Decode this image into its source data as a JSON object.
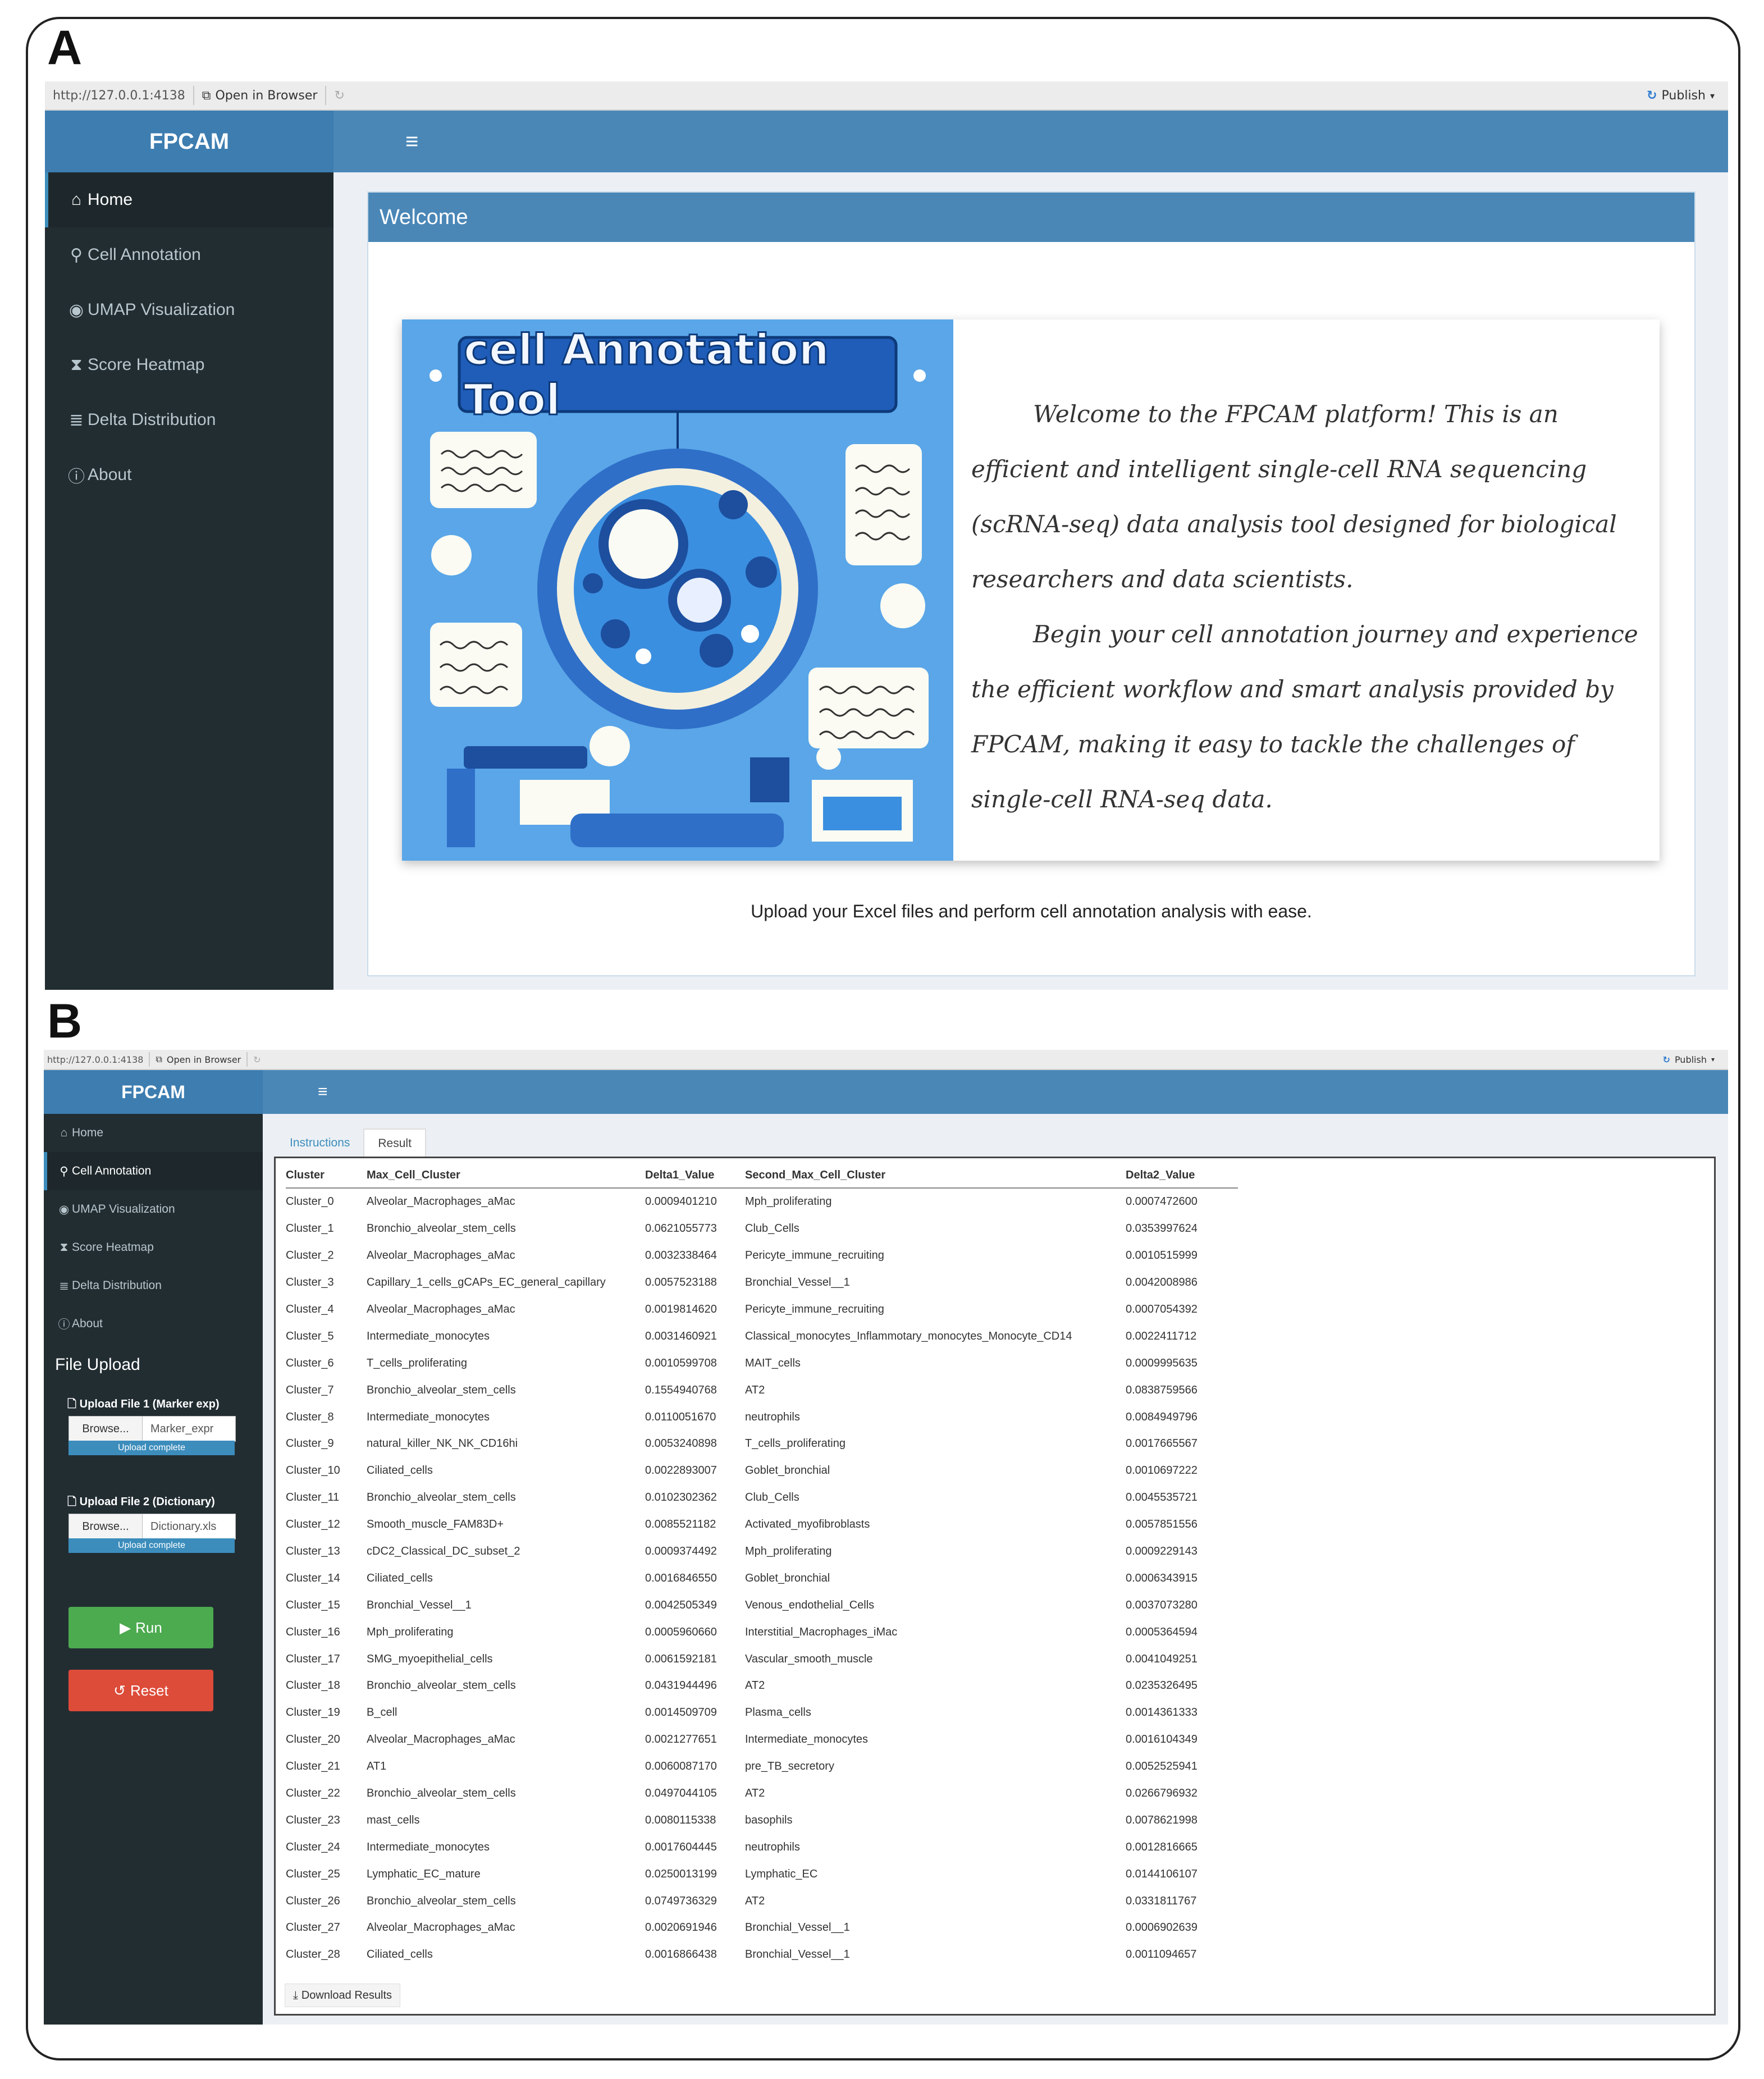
{
  "panel_a": {
    "letter": "A",
    "browser": {
      "url": "http://127.0.0.1:4138",
      "open_in_browser": "Open in Browser",
      "publish": "Publish"
    },
    "app": {
      "logo": "FPCAM",
      "hamburger": "≡",
      "sidebar": [
        {
          "label": "Home",
          "icon": "home-icon",
          "glyph": "⌂"
        },
        {
          "label": "Cell Annotation",
          "icon": "microscope-icon",
          "glyph": "⚲"
        },
        {
          "label": "UMAP Visualization",
          "icon": "eye-icon",
          "glyph": "◉"
        },
        {
          "label": "Score Heatmap",
          "icon": "hourglass-icon",
          "glyph": "⧗"
        },
        {
          "label": "Delta Distribution",
          "icon": "chart-icon",
          "glyph": "≣"
        },
        {
          "label": "About",
          "icon": "info-icon",
          "glyph": "ⓘ"
        }
      ],
      "welcome_title": "Welcome",
      "illustration_title": "cell Annotation Tool",
      "welcome_paragraph_1": "Welcome to the FPCAM platform! This is an efficient and intelligent single-cell RNA sequencing (scRNA-seq) data analysis tool designed for biological researchers and data scientists.",
      "welcome_paragraph_2": "Begin your cell annotation journey and experience the efficient workflow and smart analysis provided by FPCAM, making it easy to tackle the challenges of single-cell RNA-seq data.",
      "footer_text": "Upload your Excel files and perform cell annotation analysis with ease."
    }
  },
  "panel_b": {
    "letter": "B",
    "browser": {
      "url": "http://127.0.0.1:4138",
      "open_in_browser": "Open in Browser",
      "publish": "Publish"
    },
    "app": {
      "logo": "FPCAM",
      "hamburger": "≡",
      "sidebar": [
        {
          "label": "Home",
          "icon": "home-icon",
          "glyph": "⌂"
        },
        {
          "label": "Cell Annotation",
          "icon": "microscope-icon",
          "glyph": "⚲"
        },
        {
          "label": "UMAP Visualization",
          "icon": "eye-icon",
          "glyph": "◉"
        },
        {
          "label": "Score Heatmap",
          "icon": "hourglass-icon",
          "glyph": "⧗"
        },
        {
          "label": "Delta Distribution",
          "icon": "chart-icon",
          "glyph": "≣"
        },
        {
          "label": "About",
          "icon": "info-icon",
          "glyph": "ⓘ"
        }
      ],
      "file_upload_title": "File Upload",
      "upload1": {
        "label": "Upload File 1 (Marker exp)",
        "browse": "Browse...",
        "filename": "Marker_expr",
        "status": "Upload complete"
      },
      "upload2": {
        "label": "Upload File 2 (Dictionary)",
        "browse": "Browse...",
        "filename": "Dictionary.xls",
        "status": "Upload complete"
      },
      "run_label": "Run",
      "reset_label": "Reset",
      "tabs": [
        "Instructions",
        "Result"
      ],
      "table": {
        "headers": [
          "Cluster",
          "Max_Cell_Cluster",
          "Delta1_Value",
          "Second_Max_Cell_Cluster",
          "Delta2_Value"
        ],
        "rows": [
          [
            "Cluster_0",
            "Alveolar_Macrophages_aMac",
            "0.0009401210",
            "Mph_proliferating",
            "0.0007472600"
          ],
          [
            "Cluster_1",
            "Bronchio_alveolar_stem_cells",
            "0.0621055773",
            "Club_Cells",
            "0.0353997624"
          ],
          [
            "Cluster_2",
            "Alveolar_Macrophages_aMac",
            "0.0032338464",
            "Pericyte_immune_recruiting",
            "0.0010515999"
          ],
          [
            "Cluster_3",
            "Capillary_1_cells_gCAPs_EC_general_capillary",
            "0.0057523188",
            "Bronchial_Vessel__1",
            "0.0042008986"
          ],
          [
            "Cluster_4",
            "Alveolar_Macrophages_aMac",
            "0.0019814620",
            "Pericyte_immune_recruiting",
            "0.0007054392"
          ],
          [
            "Cluster_5",
            "Intermediate_monocytes",
            "0.0031460921",
            "Classical_monocytes_Inflammotary_monocytes_Monocyte_CD14",
            "0.0022411712"
          ],
          [
            "Cluster_6",
            "T_cells_proliferating",
            "0.0010599708",
            "MAIT_cells",
            "0.0009995635"
          ],
          [
            "Cluster_7",
            "Bronchio_alveolar_stem_cells",
            "0.1554940768",
            "AT2",
            "0.0838759566"
          ],
          [
            "Cluster_8",
            "Intermediate_monocytes",
            "0.0110051670",
            "neutrophils",
            "0.0084949796"
          ],
          [
            "Cluster_9",
            "natural_killer_NK_NK_CD16hi",
            "0.0053240898",
            "T_cells_proliferating",
            "0.0017665567"
          ],
          [
            "Cluster_10",
            "Ciliated_cells",
            "0.0022893007",
            "Goblet_bronchial",
            "0.0010697222"
          ],
          [
            "Cluster_11",
            "Bronchio_alveolar_stem_cells",
            "0.0102302362",
            "Club_Cells",
            "0.0045535721"
          ],
          [
            "Cluster_12",
            "Smooth_muscle_FAM83D+",
            "0.0085521182",
            "Activated_myofibroblasts",
            "0.0057851556"
          ],
          [
            "Cluster_13",
            "cDC2_Classical_DC_subset_2",
            "0.0009374492",
            "Mph_proliferating",
            "0.0009229143"
          ],
          [
            "Cluster_14",
            "Ciliated_cells",
            "0.0016846550",
            "Goblet_bronchial",
            "0.0006343915"
          ],
          [
            "Cluster_15",
            "Bronchial_Vessel__1",
            "0.0042505349",
            "Venous_endothelial_Cells",
            "0.0037073280"
          ],
          [
            "Cluster_16",
            "Mph_proliferating",
            "0.0005960660",
            "Interstitial_Macrophages_iMac",
            "0.0005364594"
          ],
          [
            "Cluster_17",
            "SMG_myoepithelial_cells",
            "0.0061592181",
            "Vascular_smooth_muscle",
            "0.0041049251"
          ],
          [
            "Cluster_18",
            "Bronchio_alveolar_stem_cells",
            "0.0431944496",
            "AT2",
            "0.0235326495"
          ],
          [
            "Cluster_19",
            "B_cell",
            "0.0014509709",
            "Plasma_cells",
            "0.0014361333"
          ],
          [
            "Cluster_20",
            "Alveolar_Macrophages_aMac",
            "0.0021277651",
            "Intermediate_monocytes",
            "0.0016104349"
          ],
          [
            "Cluster_21",
            "AT1",
            "0.0060087170",
            "pre_TB_secretory",
            "0.0052525941"
          ],
          [
            "Cluster_22",
            "Bronchio_alveolar_stem_cells",
            "0.0497044105",
            "AT2",
            "0.0266796932"
          ],
          [
            "Cluster_23",
            "mast_cells",
            "0.0080115338",
            "basophils",
            "0.0078621998"
          ],
          [
            "Cluster_24",
            "Intermediate_monocytes",
            "0.0017604445",
            "neutrophils",
            "0.0012816665"
          ],
          [
            "Cluster_25",
            "Lymphatic_EC_mature",
            "0.0250013199",
            "Lymphatic_EC",
            "0.0144106107"
          ],
          [
            "Cluster_26",
            "Bronchio_alveolar_stem_cells",
            "0.0749736329",
            "AT2",
            "0.0331811767"
          ],
          [
            "Cluster_27",
            "Alveolar_Macrophages_aMac",
            "0.0020691946",
            "Bronchial_Vessel__1",
            "0.0006902639"
          ],
          [
            "Cluster_28",
            "Ciliated_cells",
            "0.0016866438",
            "Bronchial_Vessel__1",
            "0.0011094657"
          ]
        ]
      },
      "download_label": "Download Results"
    }
  },
  "colors": {
    "header_blue": "#4a87b7",
    "sidebar_dark": "#222d32",
    "run_green": "#4caa4f",
    "reset_red": "#dd4b39"
  }
}
